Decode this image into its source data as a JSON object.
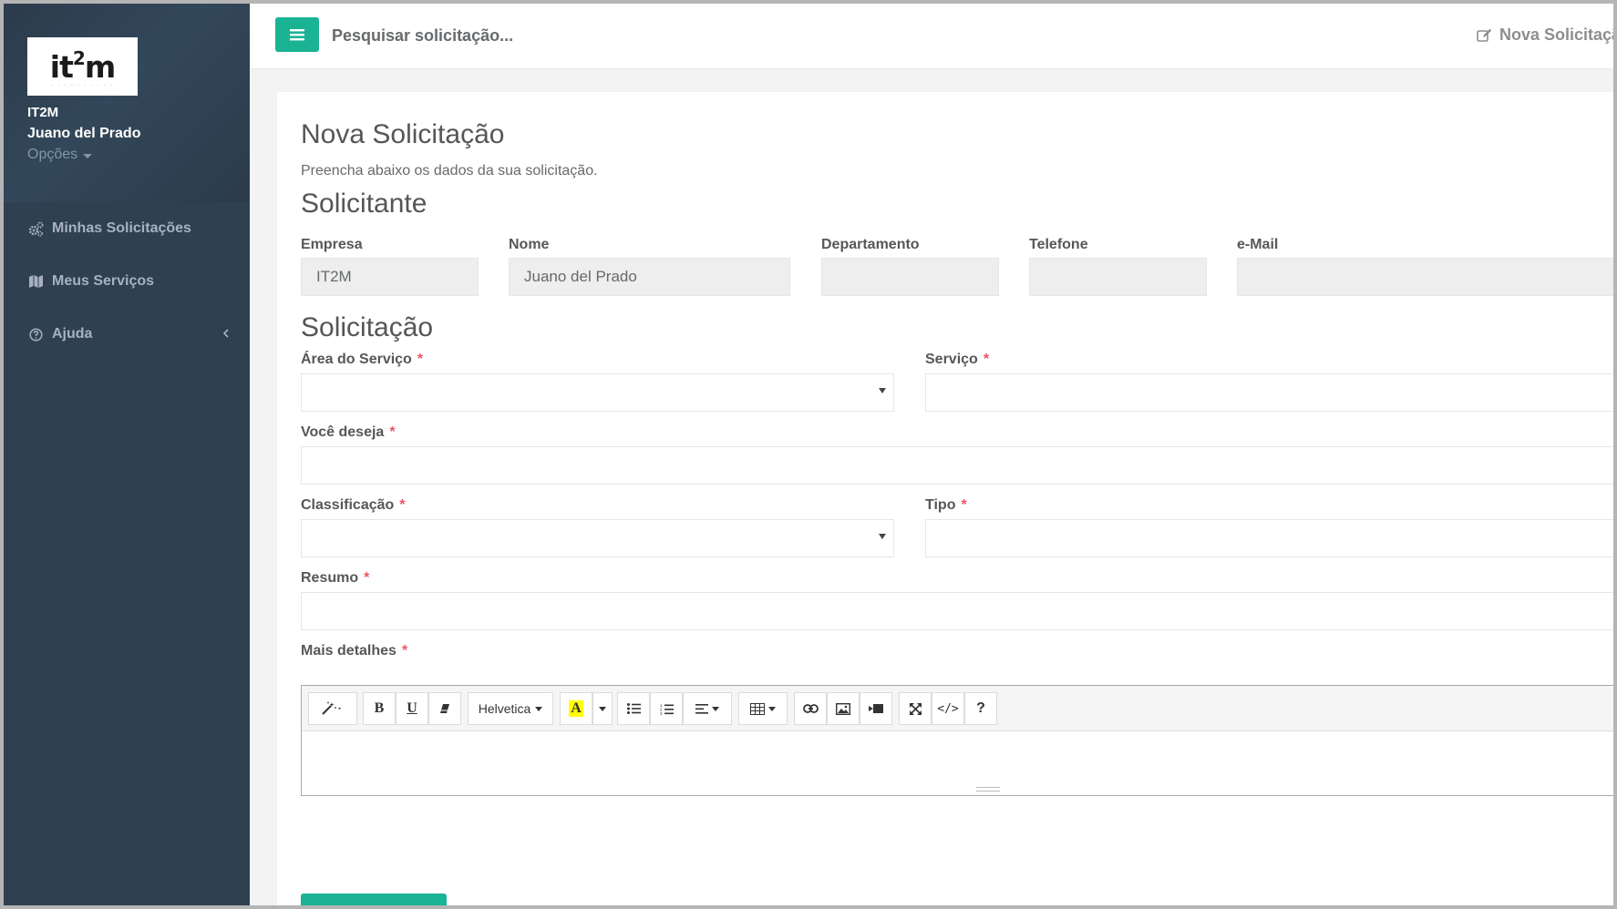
{
  "colors": {
    "sidebar_bg": "#2f4050",
    "accent": "#1ab394",
    "required": "#ed5565",
    "nav_text": "#a7b1c2"
  },
  "sidebar": {
    "logo_text": "it2m",
    "company": "IT2M",
    "user_name": "Juano del Prado",
    "options_label": "Opções",
    "items": [
      {
        "label": "Minhas Solicitações",
        "icon": "gears-icon"
      },
      {
        "label": "Meus Serviços",
        "icon": "map-icon"
      },
      {
        "label": "Ajuda",
        "icon": "question-circle-icon"
      }
    ]
  },
  "topbar": {
    "search_placeholder": "Pesquisar solicitação...",
    "new_request_label": "Nova Solicitação"
  },
  "page": {
    "title": "Nova Solicitação",
    "subtitle": "Preencha abaixo os dados da sua solicitação."
  },
  "requester": {
    "section_title": "Solicitante",
    "fields": [
      {
        "label": "Empresa",
        "value": "IT2M"
      },
      {
        "label": "Nome",
        "value": "Juano del Prado"
      },
      {
        "label": "Departamento",
        "value": ""
      },
      {
        "label": "Telefone",
        "value": ""
      },
      {
        "label": "e-Mail",
        "value": ""
      }
    ]
  },
  "request": {
    "section_title": "Solicitação",
    "required_marker": "*",
    "area_label": "Área do Serviço",
    "service_label": "Serviço",
    "wish_label": "Você deseja",
    "classification_label": "Classificação",
    "type_label": "Tipo",
    "summary_label": "Resumo",
    "details_label": "Mais detalhes"
  },
  "editor": {
    "font_name": "Helvetica",
    "tools": [
      "magic-icon",
      "bold-icon",
      "underline-icon",
      "eraser-icon",
      "font-dropdown",
      "highlight-icon",
      "unordered-list-icon",
      "ordered-list-icon",
      "align-icon",
      "table-icon",
      "link-icon",
      "picture-icon",
      "video-icon",
      "fullscreen-icon",
      "code-view-icon",
      "help-icon"
    ]
  }
}
